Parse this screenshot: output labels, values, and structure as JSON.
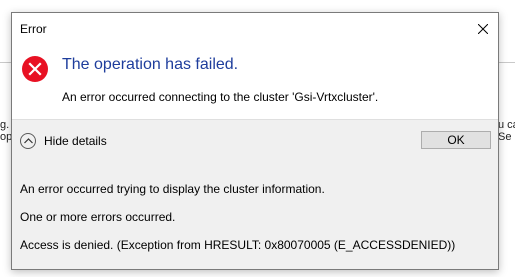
{
  "background": {
    "left_fragment_1": "g.",
    "left_fragment_2": "op",
    "right_fragment_1": "u ca",
    "right_fragment_2": "Se"
  },
  "dialog": {
    "title": "Error",
    "heading": "The operation has failed.",
    "message": "An error occurred connecting to the cluster 'Gsi-Vrtxcluster'.",
    "toggle_label": "Hide details",
    "ok_label": "OK",
    "details": [
      "An error occurred trying to display the cluster information.",
      "One or more errors occurred.",
      "Access is denied. (Exception from HRESULT: 0x80070005 (E_ACCESSDENIED))"
    ],
    "icons": {
      "error": "error-x-circle-icon",
      "close": "close-icon",
      "toggle": "chevron-up-icon"
    },
    "colors": {
      "heading": "#1e3d9c",
      "error_icon": "#e81123",
      "details_background": "#f0f0f0"
    }
  }
}
